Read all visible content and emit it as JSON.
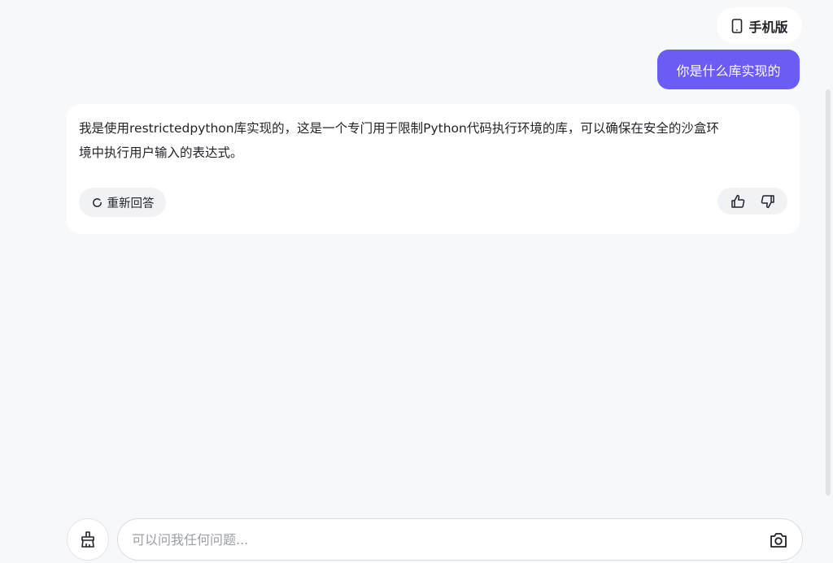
{
  "header": {
    "mobile_button_label": "手机版",
    "mobile_icon": "phone-icon"
  },
  "conversation": {
    "user_message": "你是什么库实现的",
    "assistant_message": "我是使用restrictedpython库实现的，这是一个专门用于限制Python代码执行环境的库，可以确保在安全的沙盒环\n境中执行用户输入的表达式。",
    "regenerate_label": "重新回答",
    "regenerate_icon": "refresh-icon",
    "feedback_icons": [
      "thumbs-up-icon",
      "thumbs-down-icon"
    ]
  },
  "composer": {
    "placeholder": "可以问我任何问题...",
    "clear_icon": "broom-icon",
    "camera_icon": "camera-icon"
  },
  "colors": {
    "accent": "#6b5cf6",
    "background": "#f7f8fa",
    "card": "#ffffff"
  }
}
